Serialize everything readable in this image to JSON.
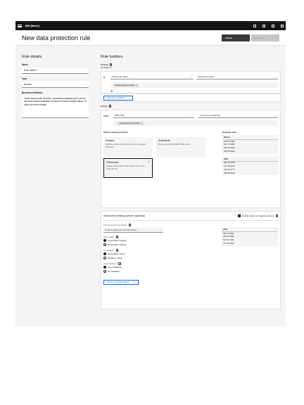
{
  "app": {
    "brand": "IBM [Name]"
  },
  "header": {
    "title": "New data protection rule",
    "cancel_label": "Cancel",
    "create_label": "Create rule"
  },
  "rule_details": {
    "heading": "Rule details",
    "name_label": "Name",
    "name_value": "Rule name 1",
    "type_label": "Type",
    "type_value": "Access",
    "definition_label": "Business definition",
    "definition_value": "Lorem ipsum dolor sit amet, consectetur adipiscing elit, sed do eiusmod tempor incididunt ut labore et dolore magna aliqua. Ut enim ad minim veniam."
  },
  "rule_builders": {
    "heading": "Rule builders",
    "criteria_label": "Criteria",
    "condition_label": "Condition 1",
    "if_label": "If",
    "option1": "Choose an option",
    "option2": "Choose an option",
    "criteria_tag": "Social security number",
    "add_condition": "Add new condition",
    "action_label": "Action",
    "then_label": "Then",
    "action_select": "Mask data",
    "columns_select": "In columns containing",
    "action_tag": "Social security number",
    "masking_heading": "Select masking method",
    "methods": [
      {
        "title": "Redact",
        "desc": "Replace values with a string of one repeated character"
      },
      {
        "title": "Substitute",
        "desc": "Replace data with MD5 hash string"
      },
      {
        "title": "Obfuscate",
        "desc": "Replace data with similar values and in the same format"
      }
    ],
    "example_heading": "Example data",
    "before_label": "Before",
    "before_values": [
      "445 99 0001",
      "334 77 0003",
      "530 99 0002",
      "230 95 0004"
    ],
    "after_label": "After",
    "after_values": [
      "060-13-4792",
      "127-93-2241",
      "370-37-0771",
      "598-08-9322"
    ],
    "advanced_heading": "Advanced masking options (optional)",
    "enable_advanced": "Enable advanced masking options",
    "format_label": "Format preserving options",
    "format_value": "Custom options for this data class",
    "reversibility_label": "Reversibility",
    "reversibility_options": [
      "Irreversible masking",
      "Reversible masking"
    ],
    "consistency_label": "Consistency",
    "consistency_options": [
      "Repeatable output",
      "Random output"
    ],
    "validation_label": "Input validation",
    "validation_options": [
      "Input validation",
      "No validation"
    ],
    "reset_label": "Reset to default options",
    "adv_after_label": "After",
    "adv_after_values": [
      "092 22 0001",
      "420 09 0002",
      "517 01 0001",
      "077 42 0002"
    ]
  }
}
